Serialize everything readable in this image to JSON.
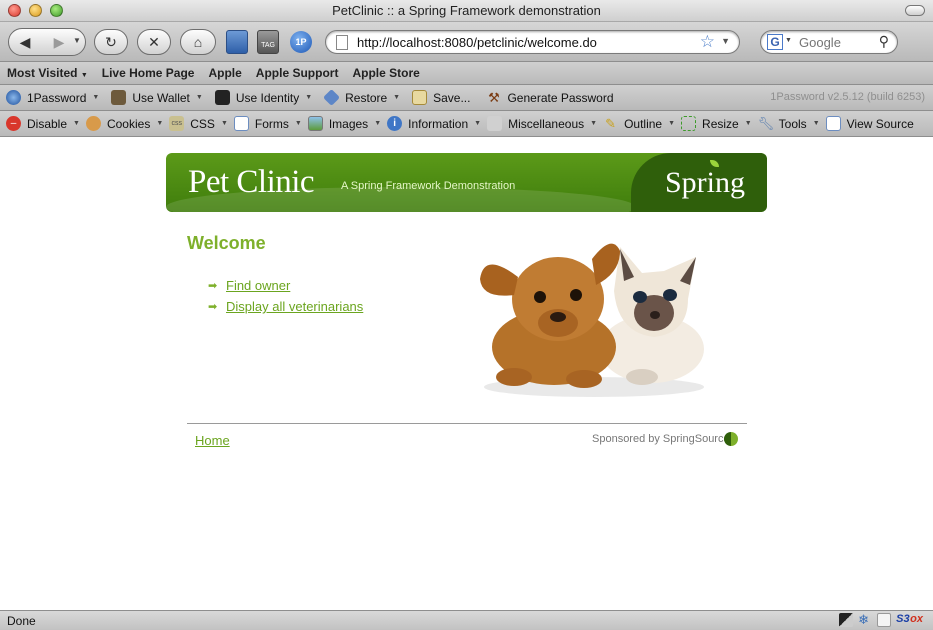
{
  "window": {
    "title": "PetClinic :: a Spring Framework demonstration"
  },
  "navbar": {
    "url": "http://localhost:8080/petclinic/welcome.do",
    "search_placeholder": "Google",
    "search_engine_letter": "G"
  },
  "bookmarks": [
    "Most Visited",
    "Live Home Page",
    "Apple",
    "Apple Support",
    "Apple Store"
  ],
  "onepassword": {
    "items": [
      "1Password",
      "Use Wallet",
      "Use Identity",
      "Restore",
      "Save...",
      "Generate Password"
    ],
    "version": "1Password v2.5.12 (build 6253)"
  },
  "webdev": {
    "items": [
      "Disable",
      "Cookies",
      "CSS",
      "Forms",
      "Images",
      "Information",
      "Miscellaneous",
      "Outline",
      "Resize",
      "Tools",
      "View Source"
    ]
  },
  "page": {
    "brand": "Pet Clinic",
    "tagline": "A Spring Framework Demonstration",
    "spring_logo": "Spring",
    "heading": "Welcome",
    "links": [
      "Find owner",
      "Display all veterinarians"
    ],
    "footer_home": "Home",
    "sponsor": "Sponsored by SpringSource"
  },
  "status": {
    "text": "Done",
    "s3fox_prefix": "S3",
    "s3fox_suffix": "ox"
  },
  "colors": {
    "banner_green": "#4a8a12",
    "accent_green": "#7eb02b",
    "link_green": "#6ba51f"
  }
}
